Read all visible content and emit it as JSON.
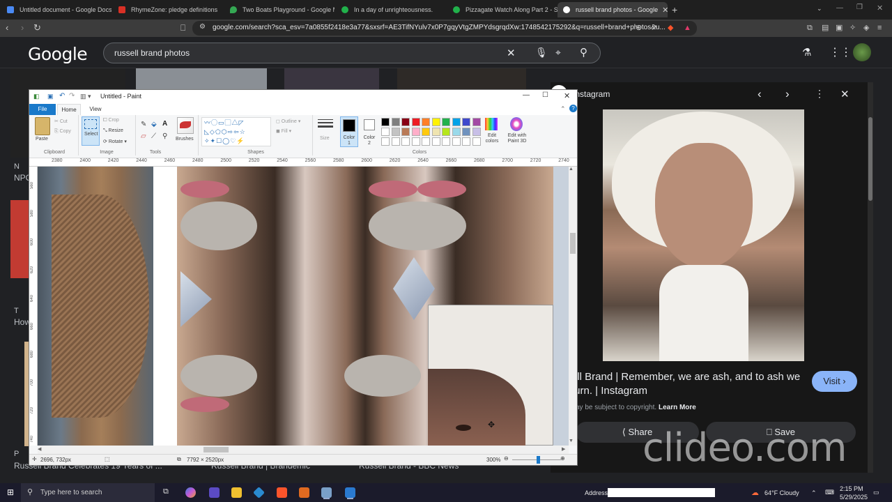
{
  "browser": {
    "tabs": [
      {
        "label": "Untitled document - Google Docs",
        "color": "#4a8af4"
      },
      {
        "label": "RhymeZone: pledge definitions",
        "color": "#d93025"
      },
      {
        "label": "Two Boats Playground - Google Ma",
        "color": "#34a853"
      },
      {
        "label": "In a day of unrighteousness.",
        "color": "#21b14b"
      },
      {
        "label": "Pizzagate Watch Along Part 2 - SFS",
        "color": "#21b14b"
      },
      {
        "label": "russell brand photos - Google",
        "color": "#ffffff"
      }
    ],
    "new_tab": "+",
    "url": "google.com/search?sca_esv=7a0855f2418e3a77&sxsrf=AE3TifNYulv7x0P7gqyVtgZMPYdsgrqdXw:1748542175292&q=russell+brand+photos&u..."
  },
  "google": {
    "logo": "Google",
    "query": "russell brand photos",
    "results": {
      "left_label_1": "N",
      "left_label_2": "NPO",
      "left_label_3": "T",
      "left_label_4": "How",
      "bottom_left": "Russell Brand Celebrates 19 Years of ...",
      "bottom_mid": "Russell Brand | Brandemic",
      "bottom_right": "Russell Brand - BBC News",
      "bottom_p": "P"
    },
    "panel": {
      "source": "Instagram",
      "title": "ell Brand | Remember, we are ash, and to ash we turn. | Instagram",
      "visit": "Visit",
      "copyright": "ay be subject to copyright.",
      "learn_more": "Learn More",
      "share": "Share",
      "save": "Save"
    }
  },
  "paint": {
    "title": "Untitled - Paint",
    "tabs": {
      "file": "File",
      "home": "Home",
      "view": "View"
    },
    "ribbon": {
      "paste": "Paste",
      "cut": "Cut",
      "copy": "Copy",
      "clipboard": "Clipboard",
      "select": "Select",
      "crop": "Crop",
      "resize": "Resize",
      "rotate": "Rotate",
      "image": "Image",
      "tools": "Tools",
      "brushes": "Brushes",
      "outline": "Outline",
      "fill": "Fill",
      "shapes": "Shapes",
      "size": "Size",
      "color1": "Color 1",
      "color2": "Color 2",
      "edit_colors": "Edit colors",
      "edit_paint3d": "Edit with Paint 3D",
      "colors": "Colors"
    },
    "palette": [
      "#000000",
      "#7f7f7f",
      "#880015",
      "#ed1c24",
      "#ff7f27",
      "#fff200",
      "#22b14c",
      "#00a2e8",
      "#3f48cc",
      "#a349a4",
      "#ffffff",
      "#c3c3c3",
      "#b97a57",
      "#ffaec9",
      "#ffc90e",
      "#efe4b0",
      "#b5e61d",
      "#99d9ea",
      "#7092be",
      "#c8bfe7"
    ],
    "ruler_h": [
      "2380",
      "2400",
      "2420",
      "2440",
      "2460",
      "2480",
      "2500",
      "2520",
      "2540",
      "2560",
      "2580",
      "2600",
      "2620",
      "2640",
      "2660",
      "2680",
      "2700",
      "2720",
      "2740"
    ],
    "ruler_v": [
      "560",
      "580",
      "600",
      "620",
      "640",
      "660",
      "680",
      "700",
      "720",
      "740"
    ],
    "status": {
      "cursor": "2696, 732px",
      "size": "7792 × 2520px",
      "zoom": "300%"
    }
  },
  "watermark": "clideo.com",
  "taskbar": {
    "search_placeholder": "Type here to search",
    "address_label": "Address",
    "weather": "64°F  Cloudy",
    "time": "2:15 PM",
    "date": "5/29/2025"
  }
}
